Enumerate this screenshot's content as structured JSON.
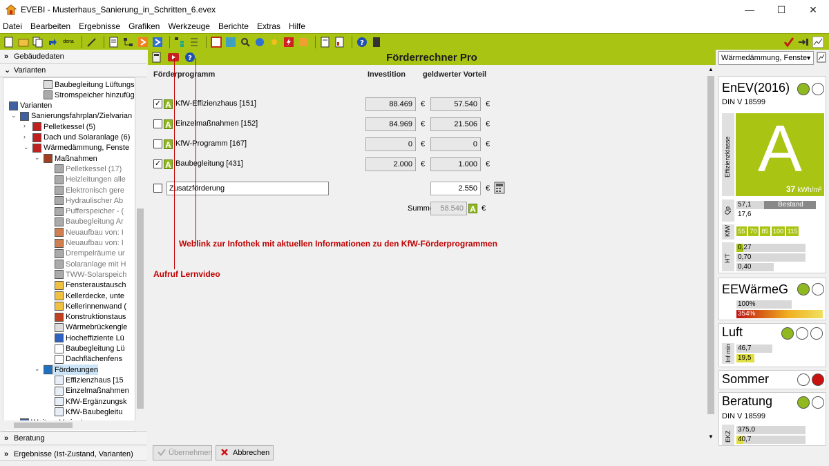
{
  "window": {
    "title": "EVEBI - Musterhaus_Sanierung_in_Schritten_6.evex"
  },
  "menu": [
    "Datei",
    "Bearbeiten",
    "Ergebnisse",
    "Grafiken",
    "Werkzeuge",
    "Berichte",
    "Extras",
    "Hilfe"
  ],
  "left": {
    "sections_top": [
      "Gebäudedaten",
      "Varianten"
    ],
    "sections_bottom": [
      "Beratung",
      "Ergebnisse (Ist-Zustand, Varianten)"
    ],
    "tree": [
      {
        "label": "Baubegleitung Lüftungsei",
        "grey": false
      },
      {
        "label": "Stromspeicher hinzufüger",
        "grey": false
      },
      {
        "label": "Varianten",
        "grey": false
      },
      {
        "label": "Sanierungsfahrplan/Zielvarian",
        "grey": false
      },
      {
        "label": "Pelletkessel (5)",
        "grey": false
      },
      {
        "label": "Dach und Solaranlage (6)",
        "grey": false
      },
      {
        "label": "Wärmedämmung, Fenste",
        "grey": false
      },
      {
        "label": "Maßnahmen",
        "grey": false
      },
      {
        "label": "Pelletkessel (17)",
        "grey": true
      },
      {
        "label": "Heizleitungen alle",
        "grey": true
      },
      {
        "label": "Elektronisch gere",
        "grey": true
      },
      {
        "label": "Hydraulischer Ab",
        "grey": true
      },
      {
        "label": "Pufferspeicher - (",
        "grey": true
      },
      {
        "label": "Baubegleitung Ar",
        "grey": true
      },
      {
        "label": "Neuaufbau von: I",
        "grey": true
      },
      {
        "label": "Neuaufbau von: I",
        "grey": true
      },
      {
        "label": "Drempelräume ur",
        "grey": true
      },
      {
        "label": "Solaranlage mit H",
        "grey": true
      },
      {
        "label": "TWW-Solarspeich",
        "grey": true
      },
      {
        "label": "Fensteraustausch",
        "grey": false
      },
      {
        "label": "Kellerdecke, unte",
        "grey": false
      },
      {
        "label": "Kellerinnenwand (",
        "grey": false
      },
      {
        "label": "Konstruktionstaus",
        "grey": false
      },
      {
        "label": "Wärmebrückengle",
        "grey": false
      },
      {
        "label": "Hocheffiziente Lü",
        "grey": false
      },
      {
        "label": "Baubegleitung Lü",
        "grey": false
      },
      {
        "label": "Dachflächenfens",
        "grey": false
      },
      {
        "label": "Förderungen",
        "grey": false
      },
      {
        "label": "Effizienzhaus [15",
        "grey": false
      },
      {
        "label": "Einzelmaßnahmen",
        "grey": false
      },
      {
        "label": "KfW-Ergänzungsk",
        "grey": false
      },
      {
        "label": "KfW-Baubegleitu",
        "grey": false
      },
      {
        "label": "Weitere Varianten",
        "grey": false
      }
    ]
  },
  "main": {
    "title": "Förderrechner Pro",
    "col_program": "Förderprogramm",
    "col_invest": "Investition",
    "col_benefit": "geldwerter Vorteil",
    "rows": [
      {
        "label": "KfW-Effizienzhaus [151]",
        "checked": true,
        "badge": "A",
        "invest": "88.469",
        "benefit": "57.540"
      },
      {
        "label": "Einzelmaßnahmen [152]",
        "checked": false,
        "badge": "A",
        "invest": "84.969",
        "benefit": "21.506"
      },
      {
        "label": "KfW-Programm [167]",
        "checked": false,
        "badge": "A",
        "invest": "0",
        "benefit": "0"
      },
      {
        "label": "Baubegleitung [431]",
        "checked": true,
        "badge": "A",
        "invest": "2.000",
        "benefit": "1.000"
      }
    ],
    "currency": "€",
    "extra": {
      "label": "Zusatzförderung",
      "value": "2.550"
    },
    "sum": {
      "label": "Summe",
      "value": "58.540",
      "badge": "A"
    },
    "annotations": {
      "weblink": "Weblink zur Infothek mit aktuellen  Informationen zu den KfW-Förderprogrammen",
      "video": "Aufruf Lernvideo"
    },
    "buttons": {
      "apply": "Übernehmen",
      "cancel": "Abbrechen"
    }
  },
  "right": {
    "variant_select": "Wärmedämmung, Fenste",
    "enev": {
      "title": "EnEV(2016)",
      "norm": "DIN V 18599",
      "class": "A",
      "class_label": "Effizienzklasse",
      "value": "37",
      "unit": "kWh/m²"
    },
    "qp": {
      "label": "Qp",
      "v1": "57,1",
      "v2": "17,6",
      "tag": "Bestand"
    },
    "kfw": {
      "label": "KfW",
      "levels": [
        "55",
        "70",
        "85",
        "100",
        "115"
      ]
    },
    "ht": {
      "label": "H'T",
      "values": [
        "0,27",
        "0,70",
        "0,40"
      ]
    },
    "eewg": {
      "title": "EEWärmeG",
      "v1": "100%",
      "v2": "354%"
    },
    "luft": {
      "title": "Luft",
      "label": "Inf min",
      "v1": "46,7",
      "v2": "19,5"
    },
    "sommer": {
      "title": "Sommer"
    },
    "beratung": {
      "title": "Beratung",
      "norm": "DIN V 18599",
      "label": "EKZ",
      "v1": "375,0",
      "v2": "40,7"
    }
  },
  "colors": {
    "accent": "#a9c413",
    "annotation": "#c00000",
    "badge": "#8fb820"
  }
}
